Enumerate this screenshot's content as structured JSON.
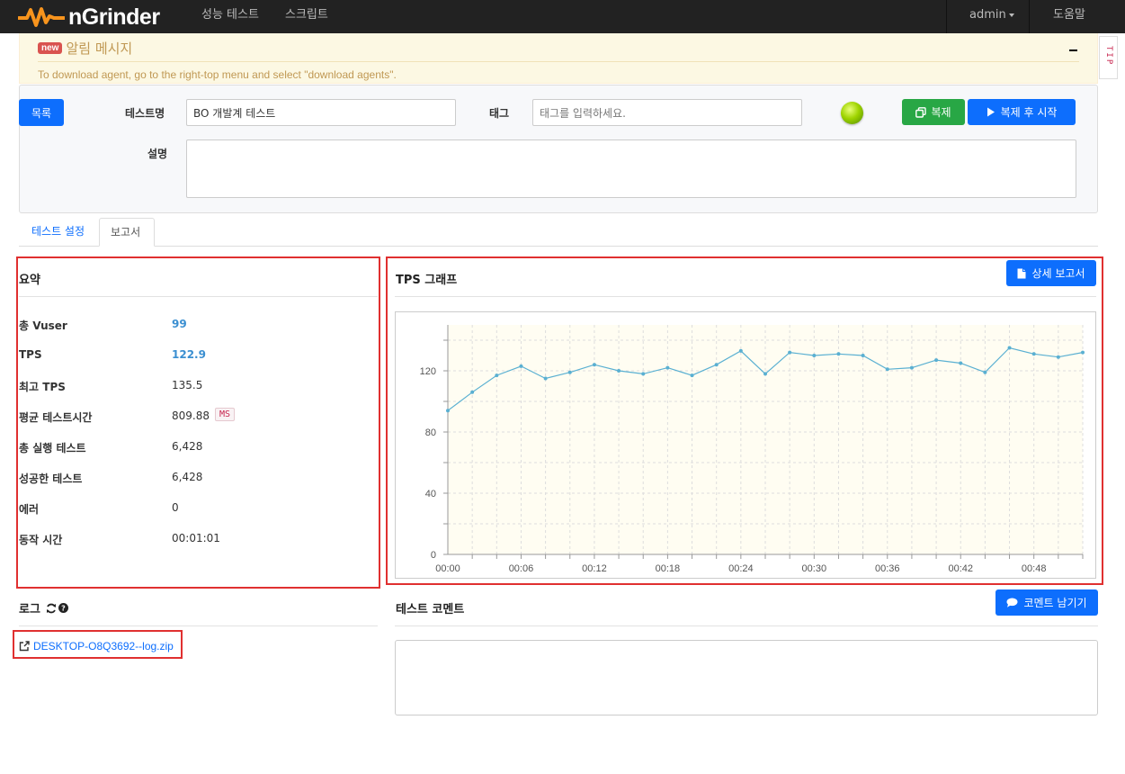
{
  "navbar": {
    "logo_text": "nGrinder",
    "menu": [
      "성능 테스트",
      "스크립트"
    ],
    "user": "admin",
    "help": "도움말"
  },
  "alert": {
    "badge": "new",
    "title": "알림 메시지",
    "message": "To download agent, go to the right-top menu and select \"download agents\".",
    "tip": "TIP"
  },
  "test": {
    "list_button": "목록",
    "name_label": "테스트명",
    "name_value": "BO 개발계 테스트",
    "tag_label": "태그",
    "tag_placeholder": "태그를 입력하세요.",
    "copy_button": "복제",
    "copy_start_button": "복제 후 시작",
    "desc_label": "설명",
    "desc_value": ""
  },
  "tabs": [
    "테스트 설정",
    "보고서"
  ],
  "summary": {
    "title": "요약",
    "rows": [
      {
        "label": "총 Vuser",
        "value": "99"
      },
      {
        "label": "TPS",
        "value": "122.9"
      },
      {
        "label": "최고 TPS",
        "value": "135.5"
      },
      {
        "label": "평균 테스트시간",
        "value": "809.88"
      },
      {
        "label": "총 실행 테스트",
        "value": "6,428"
      },
      {
        "label": "성공한 테스트",
        "value": "6,428"
      },
      {
        "label": "에러",
        "value": "0"
      },
      {
        "label": "동작 시간",
        "value": "00:01:01"
      }
    ],
    "ms_unit": "MS"
  },
  "tps": {
    "title": "TPS 그래프",
    "detail_button": "상세 보고서"
  },
  "log": {
    "title": "로그",
    "file": "DESKTOP-O8Q3692--log.zip"
  },
  "comment": {
    "title": "테스트 코멘트",
    "button": "코멘트 남기기"
  },
  "colors": {
    "accent": "#0d6efd",
    "success": "#28a745",
    "highlight": "#e03030",
    "line": "#5ab0d2",
    "plot_bg": "#fffdf2"
  },
  "chart_data": {
    "type": "line",
    "x": [
      "00:00",
      "00:02",
      "00:04",
      "00:06",
      "00:08",
      "00:10",
      "00:12",
      "00:14",
      "00:16",
      "00:18",
      "00:20",
      "00:22",
      "00:24",
      "00:26",
      "00:28",
      "00:30",
      "00:32",
      "00:34",
      "00:36",
      "00:38",
      "00:40",
      "00:42",
      "00:44",
      "00:46",
      "00:48",
      "00:50",
      "00:52"
    ],
    "values": [
      94,
      106,
      117,
      123,
      115,
      119,
      124,
      120,
      118,
      122,
      117,
      124,
      133,
      118,
      132,
      130,
      131,
      130,
      121,
      122,
      127,
      125,
      119,
      135,
      131,
      129,
      132
    ],
    "x_tick_labels": [
      "00:00",
      "00:06",
      "00:12",
      "00:18",
      "00:24",
      "00:30",
      "00:36",
      "00:42",
      "00:48"
    ],
    "y_tick_labels": [
      "0",
      "40",
      "80",
      "120"
    ],
    "ylim": [
      0,
      150
    ],
    "grid": true
  }
}
